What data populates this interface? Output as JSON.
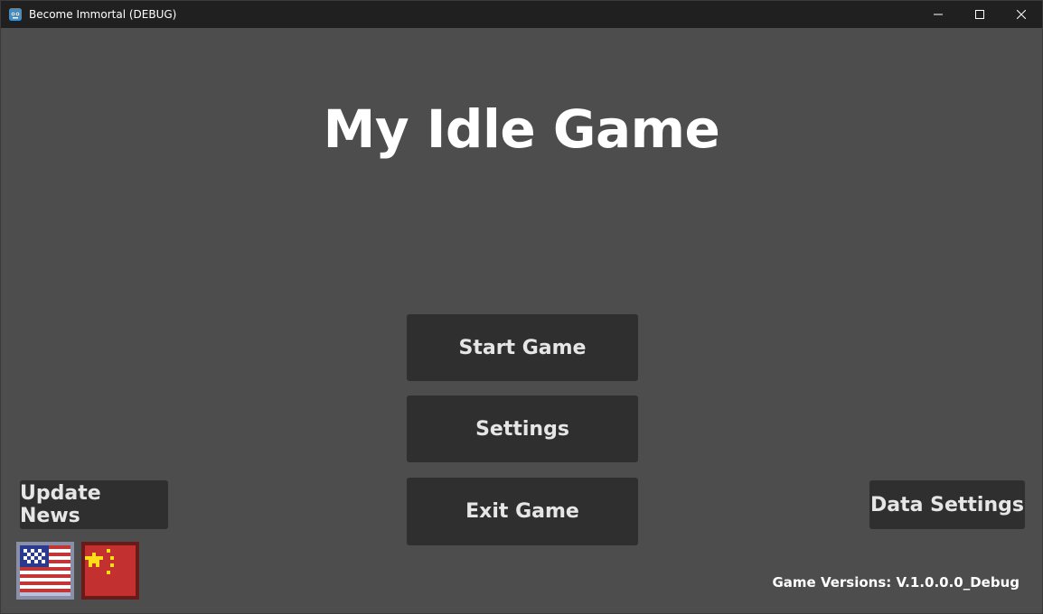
{
  "window": {
    "title": "Become Immortal (DEBUG)",
    "controls": [
      "minimize-icon",
      "maximize-icon",
      "close-icon"
    ]
  },
  "game": {
    "title": "My Idle Game",
    "menu": {
      "start_label": "Start Game",
      "settings_label": "Settings",
      "exit_label": "Exit Game"
    },
    "update_news_label": "Update News",
    "data_settings_label": "Data Settings",
    "languages": [
      "us-flag-icon",
      "china-flag-icon"
    ],
    "version_text": "Game Versions: V.1.0.0.0_Debug"
  },
  "colors": {
    "background": "#4d4d4d",
    "titlebar": "#202020",
    "button": "#2f2f2f",
    "button_text": "#e6e6e6",
    "title_text": "#ffffff"
  }
}
